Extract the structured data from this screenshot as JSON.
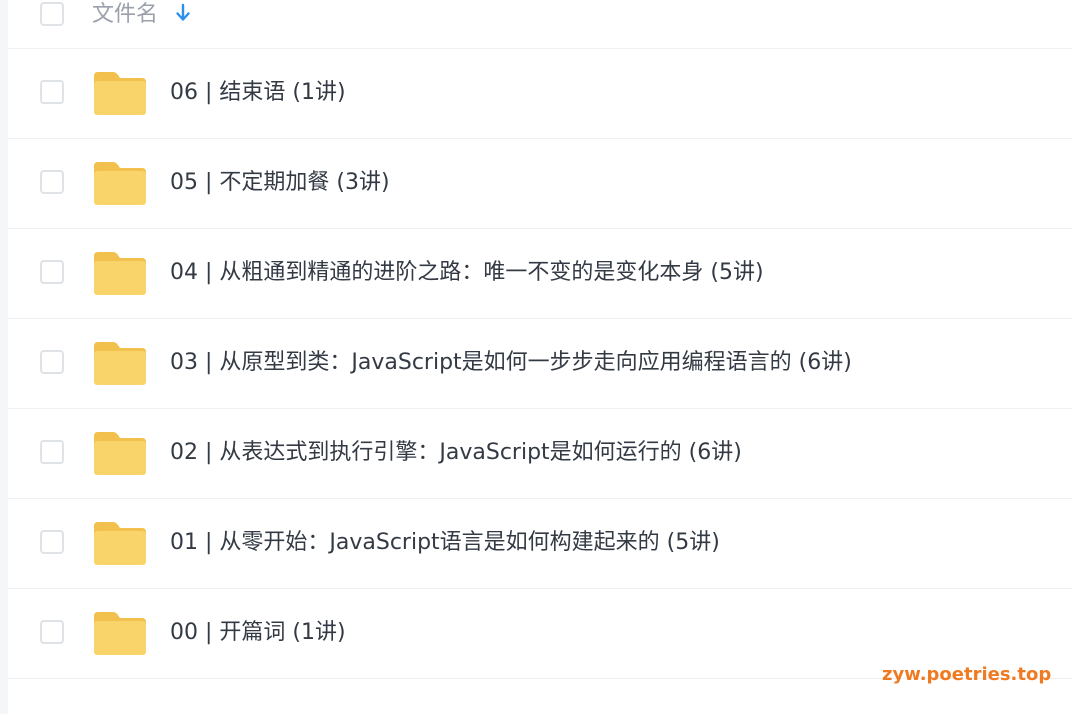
{
  "header": {
    "column_label": "文件名",
    "sort_icon": "arrow-down-icon",
    "sort_color": "#2b8ff0"
  },
  "rows": [
    {
      "title": "06 | 结束语 (1讲)",
      "icon": "folder-icon"
    },
    {
      "title": "05 | 不定期加餐 (3讲)",
      "icon": "folder-icon"
    },
    {
      "title": "04 | 从粗通到精通的进阶之路：唯一不变的是变化本身 (5讲)",
      "icon": "folder-icon"
    },
    {
      "title": "03 | 从原型到类：JavaScript是如何一步步走向应用编程语言的 (6讲)",
      "icon": "folder-icon"
    },
    {
      "title": "02 | 从表达式到执行引擎：JavaScript是如何运行的 (6讲)",
      "icon": "folder-icon"
    },
    {
      "title": "01 | 从零开始：JavaScript语言是如何构建起来的 (5讲)",
      "icon": "folder-icon"
    },
    {
      "title": "00 | 开篇词 (1讲)",
      "icon": "folder-icon"
    }
  ],
  "colors": {
    "folder_fill": "#f9d46b",
    "folder_tab": "#f2c04c",
    "watermark": "#f07a22"
  },
  "watermark": "zyw.poetries.top"
}
